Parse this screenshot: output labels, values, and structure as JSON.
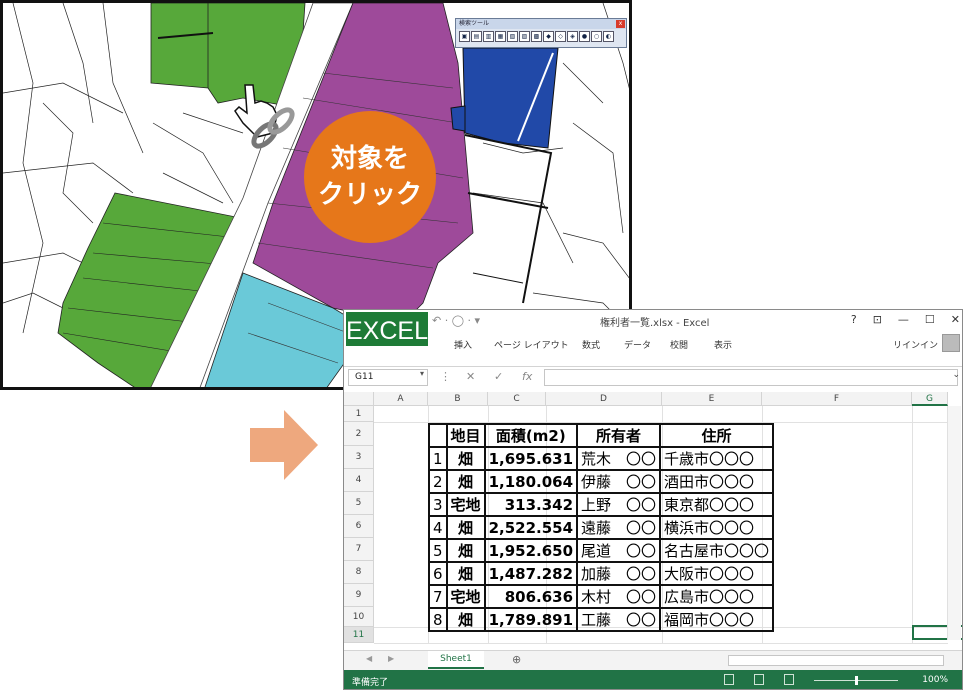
{
  "callout": {
    "line1": "対象を",
    "line2": "クリック"
  },
  "toolbar": {
    "title": "検索ツール"
  },
  "excel": {
    "badge": "EXCEL",
    "title": "権利者一覧.xlsx - Excel",
    "ribbon_tabs": [
      "挿入",
      "ページ レイアウト",
      "数式",
      "データ",
      "校閲",
      "表示"
    ],
    "user": "リインイン",
    "window_controls": [
      "?",
      "⊡",
      "—",
      "☐",
      "✕"
    ],
    "name_box": "G11",
    "fx": "fx",
    "columns": [
      "A",
      "B",
      "C",
      "D",
      "E",
      "F",
      "G"
    ],
    "rows": [
      "1",
      "2",
      "3",
      "4",
      "5",
      "6",
      "7",
      "8",
      "9",
      "10",
      "11"
    ],
    "headers": [
      "地目",
      "面積(m2)",
      "所有者",
      "住所"
    ],
    "records": [
      {
        "no": "1",
        "type": "畑",
        "area": "1,695.631",
        "owner": "荒木　〇〇",
        "address": "千歳市〇〇〇"
      },
      {
        "no": "2",
        "type": "畑",
        "area": "1,180.064",
        "owner": "伊藤　〇〇",
        "address": "酒田市〇〇〇"
      },
      {
        "no": "3",
        "type": "宅地",
        "area": "313.342",
        "owner": "上野　〇〇",
        "address": "東京都〇〇〇"
      },
      {
        "no": "4",
        "type": "畑",
        "area": "2,522.554",
        "owner": "遠藤　〇〇",
        "address": "横浜市〇〇〇"
      },
      {
        "no": "5",
        "type": "畑",
        "area": "1,952.650",
        "owner": "尾道　〇〇",
        "address": "名古屋市〇〇〇"
      },
      {
        "no": "6",
        "type": "畑",
        "area": "1,487.282",
        "owner": "加藤　〇〇",
        "address": "大阪市〇〇〇"
      },
      {
        "no": "7",
        "type": "宅地",
        "area": "806.636",
        "owner": "木村　〇〇",
        "address": "広島市〇〇〇"
      },
      {
        "no": "8",
        "type": "畑",
        "area": "1,789.891",
        "owner": "工藤　〇〇",
        "address": "福岡市〇〇〇"
      }
    ],
    "sheet_tab": "Sheet1",
    "status": "準備完了",
    "zoom": "100%"
  }
}
